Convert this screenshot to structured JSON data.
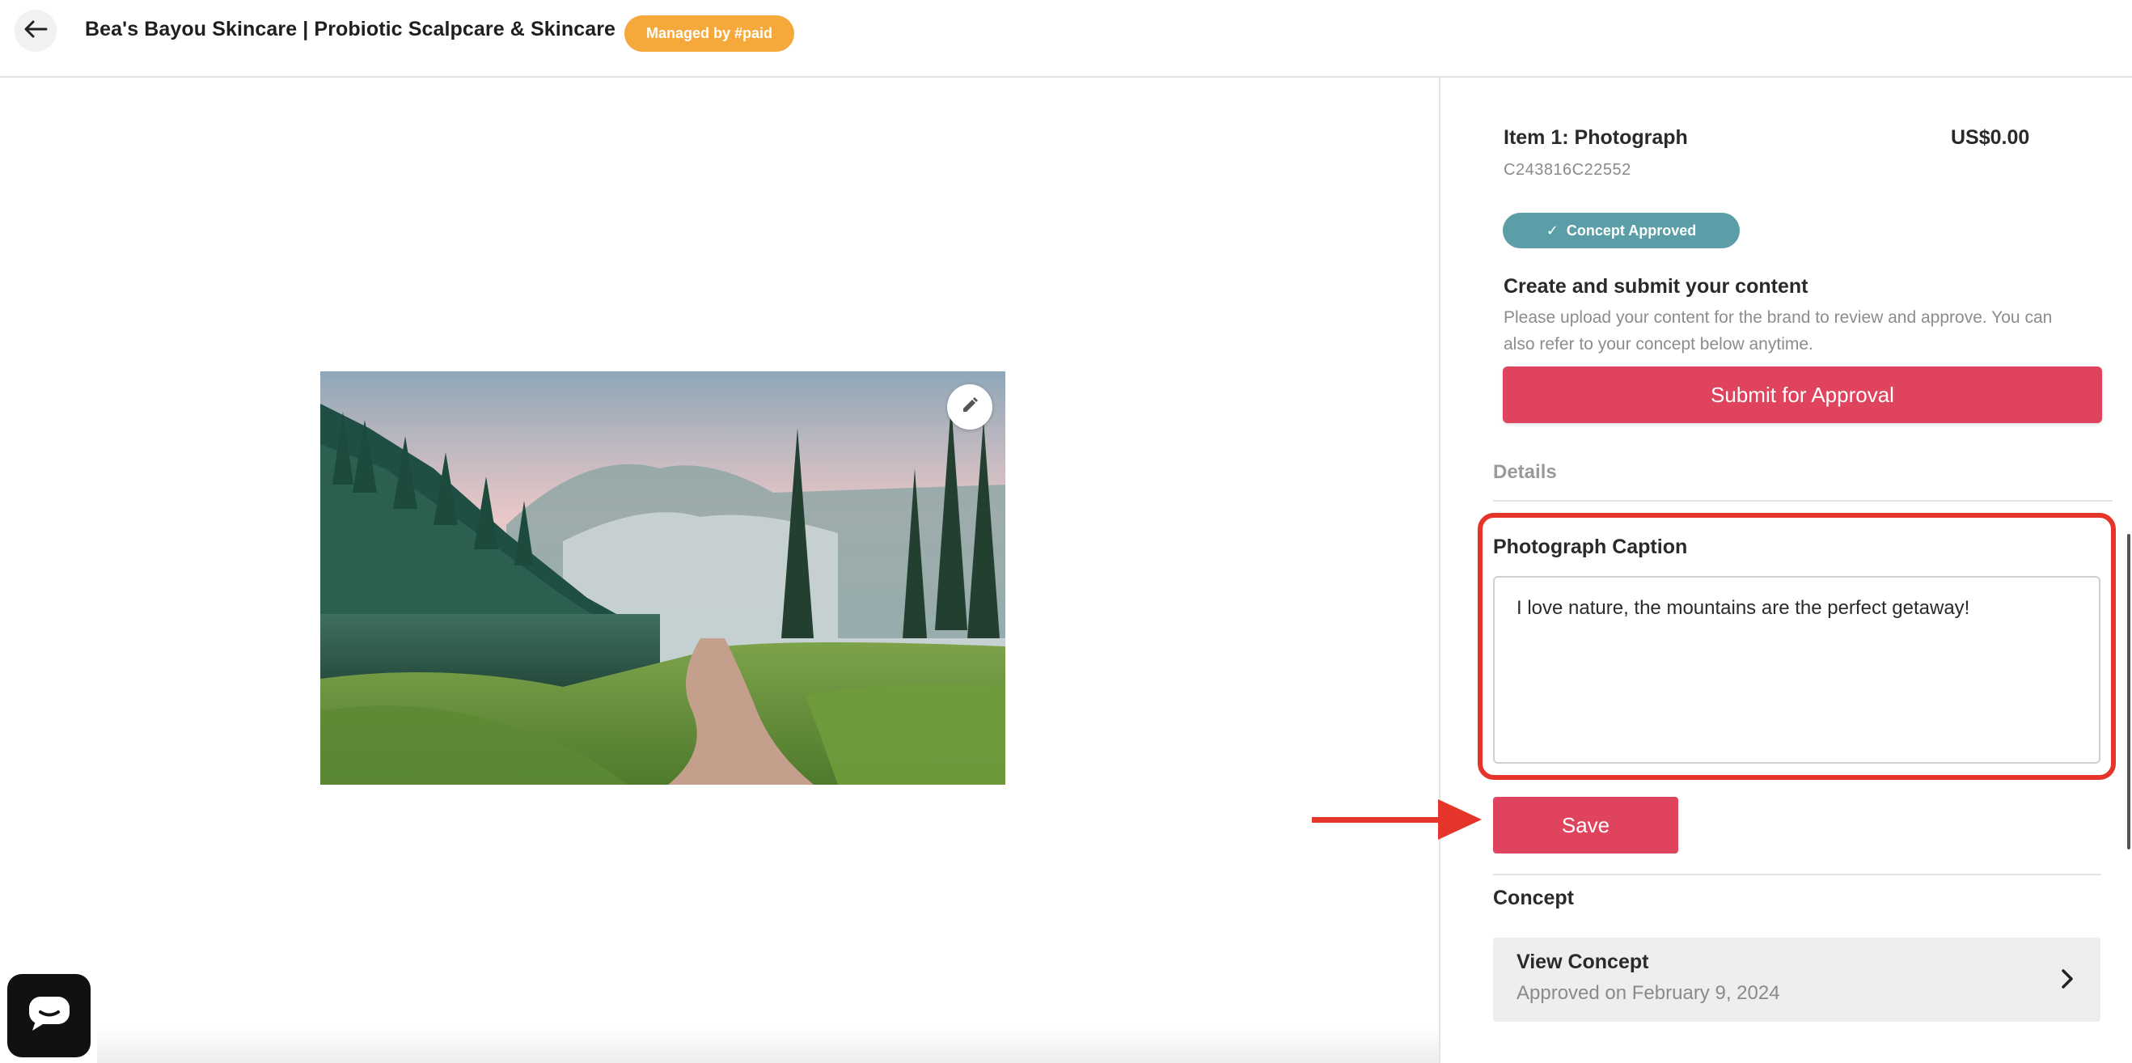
{
  "header": {
    "title": "Bea's Bayou Skincare | Probiotic Scalpcare & Skincare",
    "badge": "Managed by #paid"
  },
  "icons": {
    "back": "arrow-left-icon",
    "edit": "pencil-icon",
    "chat": "chat-bubble-icon",
    "status_check": "check-icon",
    "chevron": "chevron-right-icon"
  },
  "colors": {
    "accent": "#e0435e",
    "badge_orange": "#f5a93b",
    "status_teal": "#5b9ea7",
    "annotation_red": "#e5352a"
  },
  "item": {
    "title": "Item 1: Photograph",
    "price": "US$0.00",
    "code": "C243816C22552",
    "status": "Concept Approved",
    "status_check": "✓"
  },
  "submit_section": {
    "heading": "Create and submit your content",
    "description": "Please upload your content for the brand to review and approve. You can also refer to your concept below anytime.",
    "button": "Submit for Approval"
  },
  "details": {
    "label": "Details",
    "caption_label": "Photograph Caption",
    "caption_value": "I love nature, the mountains are the perfect getaway!",
    "save_button": "Save"
  },
  "concept": {
    "heading": "Concept",
    "card_title": "View Concept",
    "card_subtitle": "Approved on February 9, 2024"
  }
}
